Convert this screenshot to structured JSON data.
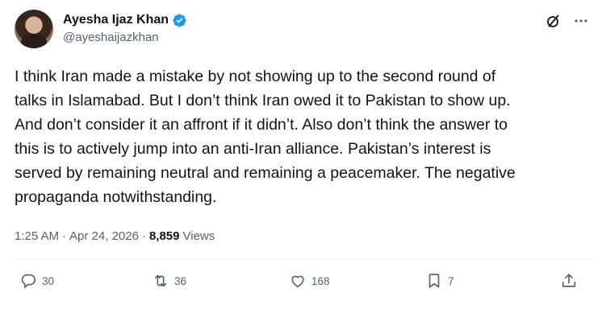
{
  "author": {
    "display_name": "Ayesha Ijaz Khan",
    "handle": "@ayeshaijazkhan",
    "verified": true
  },
  "tweet": {
    "text": "I think Iran made a mistake by not showing up to the second round of\ntalks in Islamabad. But I don’t think Iran owed it to Pakistan to show up.\nAnd don’t consider it an affront if it didn’t. Also don’t think the answer to\nthis is to actively jump into an anti-Iran alliance. Pakistan’s interest is\nserved by remaining neutral and remaining a peacemaker. The negative\npropaganda notwithstanding."
  },
  "meta": {
    "time": "1:25 AM",
    "sep1": "·",
    "date": "Apr 24, 2026",
    "sep2": "·",
    "views_count": "8,859",
    "views_label": "Views"
  },
  "actions": {
    "replies": "30",
    "reposts": "36",
    "likes": "168",
    "bookmarks": "7"
  },
  "colors": {
    "verified": "#1d9bf0",
    "text": "#0f1419",
    "muted": "#536471"
  },
  "icons": [
    "verified-badge-icon",
    "grok-icon",
    "more-icon",
    "reply-icon",
    "repost-icon",
    "like-icon",
    "bookmark-icon",
    "share-icon"
  ]
}
